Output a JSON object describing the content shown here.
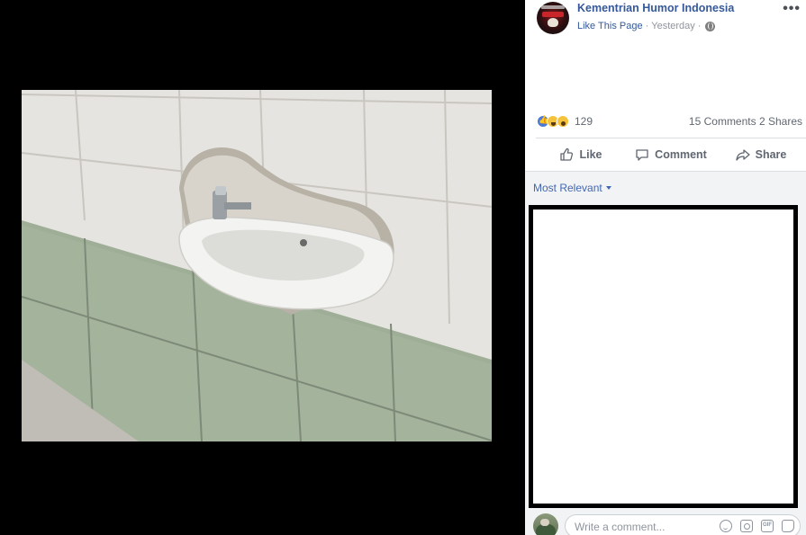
{
  "post": {
    "page_name": "Kementrian Humor Indonesia",
    "like_page": "Like This Page",
    "separator": "·",
    "time": "Yesterday",
    "more": "•••"
  },
  "stats": {
    "reaction_count": "129",
    "comments": "15 Comments",
    "shares": "2 Shares"
  },
  "actions": {
    "like": "Like",
    "comment": "Comment",
    "share": "Share"
  },
  "sort": {
    "label": "Most Relevant"
  },
  "composer": {
    "placeholder": "Write a comment...",
    "gif": "GIF"
  },
  "icons": [
    "more-options-icon",
    "globe-icon",
    "like-reaction-icon",
    "haha-reaction-icon",
    "wow-reaction-icon",
    "like-icon",
    "comment-icon",
    "share-icon",
    "emoji-icon",
    "camera-icon",
    "gif-icon",
    "sticker-icon"
  ],
  "colors": {
    "link": "#365899",
    "accent": "#4267b2",
    "muted": "#616770",
    "divider": "#dadde1"
  }
}
